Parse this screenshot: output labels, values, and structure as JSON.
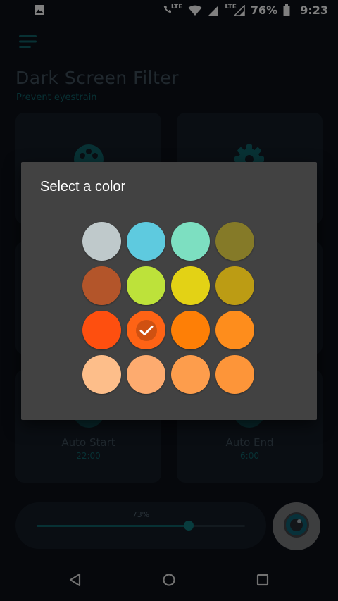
{
  "status_bar": {
    "network_label": "LTE",
    "network_label_2": "LTE",
    "battery": "76%",
    "time": "9:23"
  },
  "app": {
    "title": "Dark Screen Filter",
    "subtitle": "Prevent eyestrain",
    "cards": {
      "auto_start": {
        "label": "Auto Start",
        "time": "22:00"
      },
      "auto_end": {
        "label": "Auto End",
        "time": "6:00"
      }
    },
    "slider": {
      "percent_label": "73%",
      "value_fraction": 0.73
    }
  },
  "dialog": {
    "title": "Select a color",
    "swatches": [
      {
        "name": "swatch-light-gray-blue",
        "color": "#bfc9cb",
        "selected": false
      },
      {
        "name": "swatch-sky-blue",
        "color": "#5ecadf",
        "selected": false
      },
      {
        "name": "swatch-mint",
        "color": "#7ddfc1",
        "selected": false
      },
      {
        "name": "swatch-olive",
        "color": "#857a28",
        "selected": false
      },
      {
        "name": "swatch-rust",
        "color": "#b3552a",
        "selected": false
      },
      {
        "name": "swatch-lime",
        "color": "#bde23a",
        "selected": false
      },
      {
        "name": "swatch-yellow",
        "color": "#e3d215",
        "selected": false
      },
      {
        "name": "swatch-mustard",
        "color": "#bc9c14",
        "selected": false
      },
      {
        "name": "swatch-red-orange",
        "color": "#fe4f0f",
        "selected": false
      },
      {
        "name": "swatch-deep-orange",
        "color": "#fe6315",
        "selected": true
      },
      {
        "name": "swatch-orange",
        "color": "#fe7f06",
        "selected": false
      },
      {
        "name": "swatch-light-orange",
        "color": "#fe8d1c",
        "selected": false
      },
      {
        "name": "swatch-peach",
        "color": "#fdbe8a",
        "selected": false
      },
      {
        "name": "swatch-apricot",
        "color": "#fdab6f",
        "selected": false
      },
      {
        "name": "swatch-tangerine-light",
        "color": "#fd9d4c",
        "selected": false
      },
      {
        "name": "swatch-tangerine",
        "color": "#fd9539",
        "selected": false
      }
    ]
  },
  "icons": {
    "image": "image-icon",
    "menu": "menu-icon",
    "palette": "palette-icon",
    "settings": "gear-icon",
    "eye": "eye-icon",
    "check": "check-icon",
    "back": "back-icon",
    "home": "home-icon",
    "recents": "recents-icon"
  },
  "colors": {
    "accent": "#0f5a5f",
    "dialog_bg": "#424242",
    "app_bg": "#0b0f17",
    "card_bg": "#131a23"
  }
}
